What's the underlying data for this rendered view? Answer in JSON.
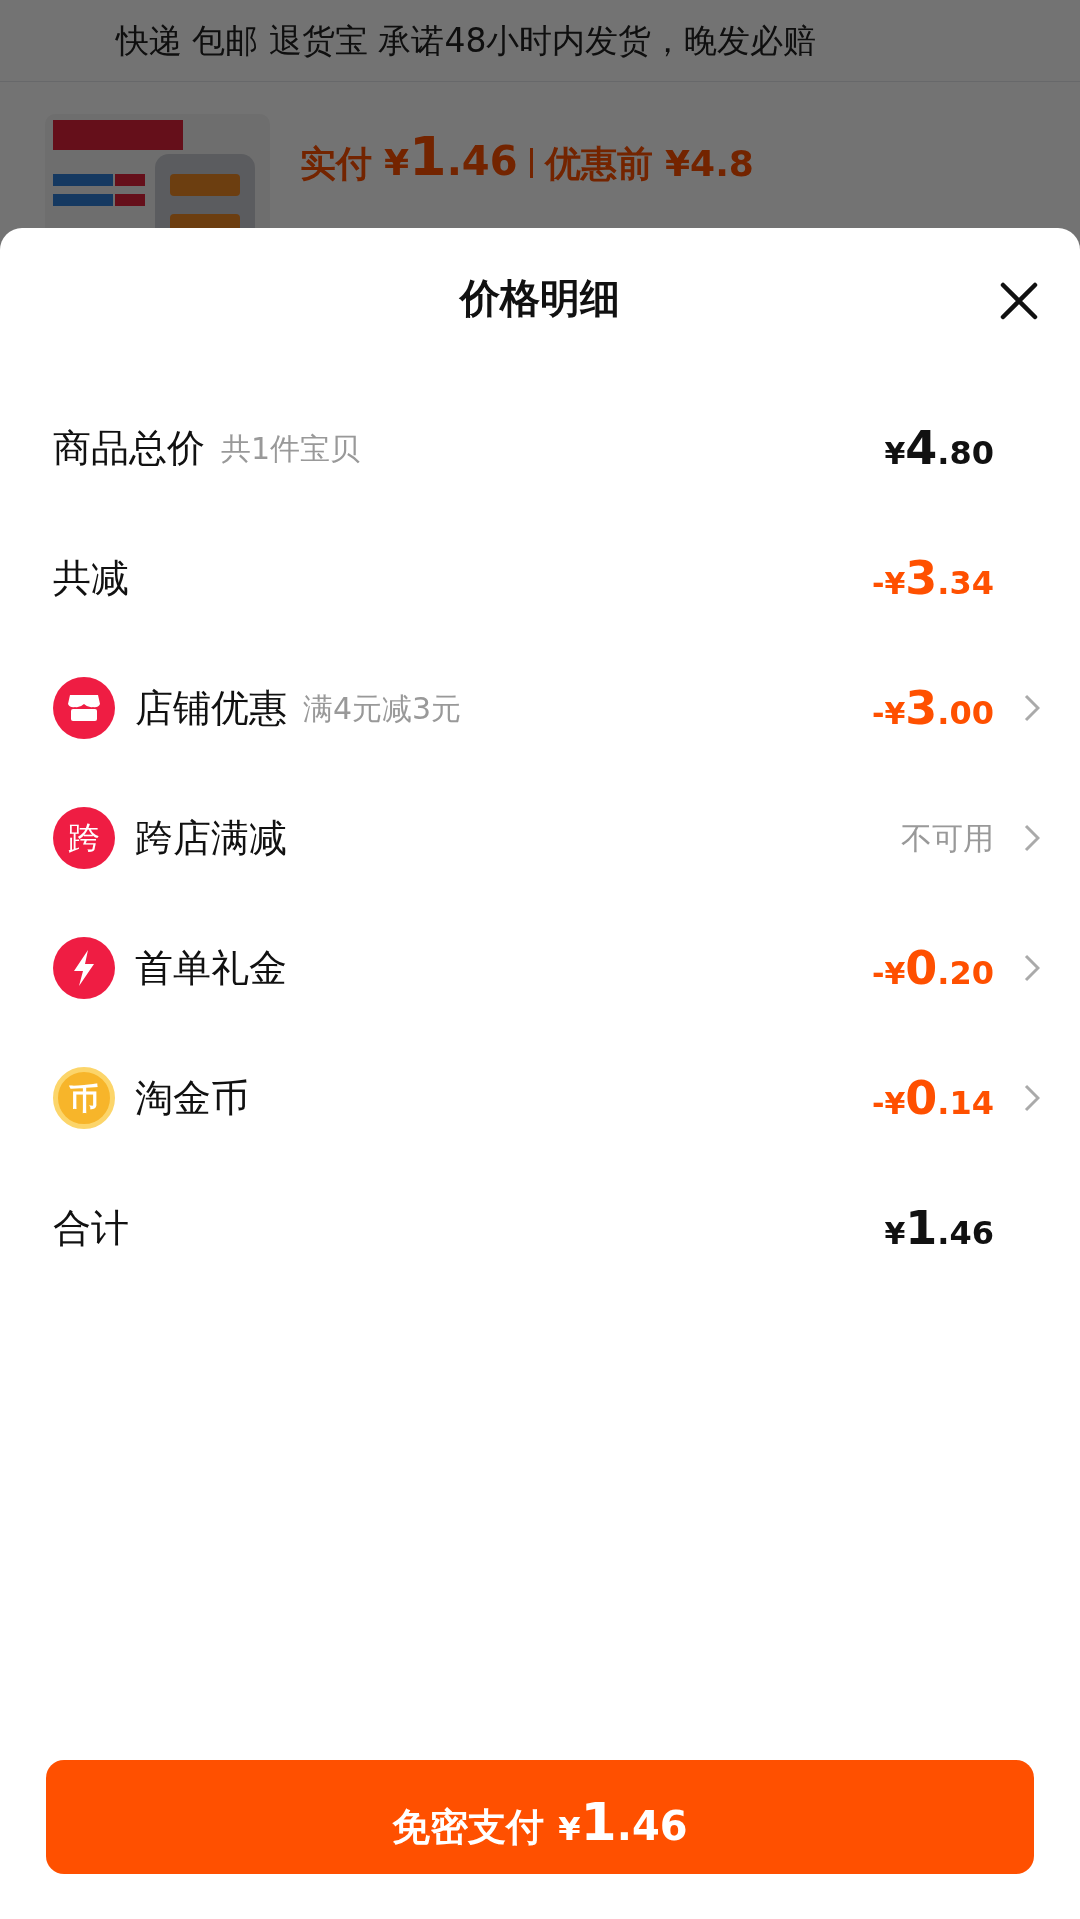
{
  "background_page": {
    "service_line": "快递 包邮 退货宝 承诺48小时内发货，晚发必赔",
    "product": {
      "paid_label": "实付",
      "paid_prefix": "¥",
      "paid_major": "1",
      "paid_minor": ".46",
      "before_label": "优惠前 ¥4.8"
    }
  },
  "sheet": {
    "title": "价格明细",
    "rows": [
      {
        "kind": "plain",
        "label": "商品总价",
        "note": "共1件宝贝",
        "discount": false,
        "prefix": "¥",
        "major": "4",
        "minor": ".80",
        "has_arrow": false
      },
      {
        "kind": "plain",
        "label": "共减",
        "discount": true,
        "prefix": "-¥",
        "major": "3",
        "minor": ".34",
        "has_arrow": false
      },
      {
        "kind": "store",
        "label": "店铺优惠",
        "note": "满4元减3元",
        "discount": true,
        "prefix": "-¥",
        "major": "3",
        "minor": ".00",
        "has_arrow": true
      },
      {
        "kind": "cross",
        "icon_text": "跨",
        "label": "跨店满减",
        "discount": false,
        "status": "不可用",
        "has_arrow": true
      },
      {
        "kind": "bolt",
        "label": "首单礼金",
        "discount": true,
        "prefix": "-¥",
        "major": "0",
        "minor": ".20",
        "has_arrow": true
      },
      {
        "kind": "coin",
        "icon_text": "币",
        "label": "淘金币",
        "discount": true,
        "prefix": "-¥",
        "major": "0",
        "minor": ".14",
        "has_arrow": true
      },
      {
        "kind": "plain",
        "label": "合计",
        "discount": false,
        "prefix": "¥",
        "major": "1",
        "minor": ".46",
        "has_arrow": false
      }
    ],
    "pay_button": {
      "label": "免密支付",
      "prefix": "¥",
      "major": "1",
      "minor": ".46"
    }
  }
}
